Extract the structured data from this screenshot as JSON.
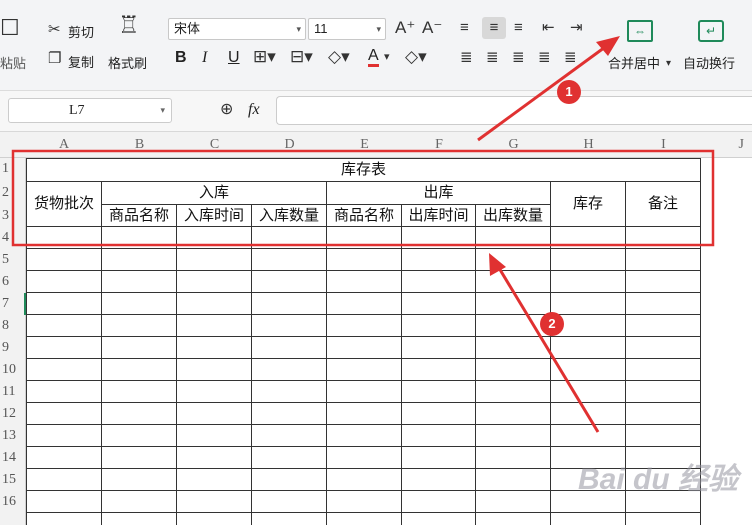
{
  "toolbar": {
    "paste_label": "粘贴",
    "cut_label": "剪切",
    "copy_label": "复制",
    "format_painter_label": "格式刷",
    "font_name": "宋体",
    "font_size": "11",
    "bold": "B",
    "italic": "I",
    "underline": "U",
    "font_color_glyph": "A",
    "merge_center_label": "合并居中",
    "wrap_text_label": "自动换行"
  },
  "formula_bar": {
    "name_box": "L7",
    "fx": "fx"
  },
  "columns": [
    "A",
    "B",
    "C",
    "D",
    "E",
    "F",
    "G",
    "H",
    "I",
    "J"
  ],
  "rows": [
    "1",
    "2",
    "3",
    "4",
    "5",
    "6",
    "7",
    "8",
    "9",
    "10",
    "11",
    "12",
    "13",
    "14",
    "15",
    "16"
  ],
  "sheet": {
    "title": "库存表",
    "batch": "货物批次",
    "inbound": "入库",
    "outbound": "出库",
    "stock": "库存",
    "note": "备注",
    "in_product": "商品名称",
    "in_time": "入库时间",
    "in_qty": "入库数量",
    "out_product": "商品名称",
    "out_time": "出库时间",
    "out_qty": "出库数量"
  },
  "annotations": {
    "badge1": "1",
    "badge2": "2",
    "accent": "#e03131"
  },
  "watermark": "Bai du 经验"
}
